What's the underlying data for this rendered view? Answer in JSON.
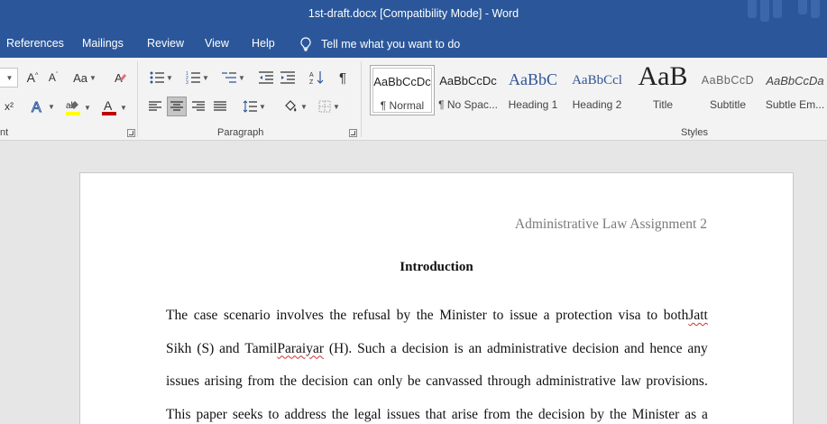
{
  "titlebar": {
    "title": "1st-draft.docx [Compatibility Mode]  -  Word"
  },
  "menu": {
    "tabs": [
      "References",
      "Mailings",
      "Review",
      "View",
      "Help"
    ],
    "tell_me": "Tell me what you want to do"
  },
  "ribbon": {
    "font_group_label": "nt",
    "paragraph_group_label": "Paragraph",
    "styles_group_label": "Styles",
    "styles": [
      {
        "sample": "AaBbCcDc",
        "name": "¶ Normal"
      },
      {
        "sample": "AaBbCcDc",
        "name": "¶ No Spac..."
      },
      {
        "sample": "AaBbC",
        "name": "Heading 1"
      },
      {
        "sample": "AaBbCcl",
        "name": "Heading 2"
      },
      {
        "sample": "AaB",
        "name": "Title"
      },
      {
        "sample": "AaBbCcD",
        "name": "Subtitle"
      },
      {
        "sample": "AaBbCcDa",
        "name": "Subtle Em..."
      }
    ],
    "font_buttons": {
      "change_case": "Aa",
      "superscript": "x²"
    }
  },
  "document": {
    "header": "Administrative Law Assignment 2",
    "heading": "Introduction",
    "lines": [
      [
        "The case scenario involves the refusal by the Minister to issue a protection visa to both ",
        "Jatt",
        ""
      ],
      [
        "Sikh (S) and Tamil ",
        "Paraiyar",
        " (H). Such a decision is an administrative decision and hence any"
      ],
      [
        "issues arising from the decision can only be canvassed through administrative law provisions.",
        "",
        ""
      ],
      [
        "This paper seeks to address the legal issues that arise from the decision by the Minister as a",
        "",
        ""
      ]
    ]
  },
  "colors": {
    "accent": "#2b579a",
    "font_color": "#c00000",
    "highlight": "#ffff00"
  }
}
